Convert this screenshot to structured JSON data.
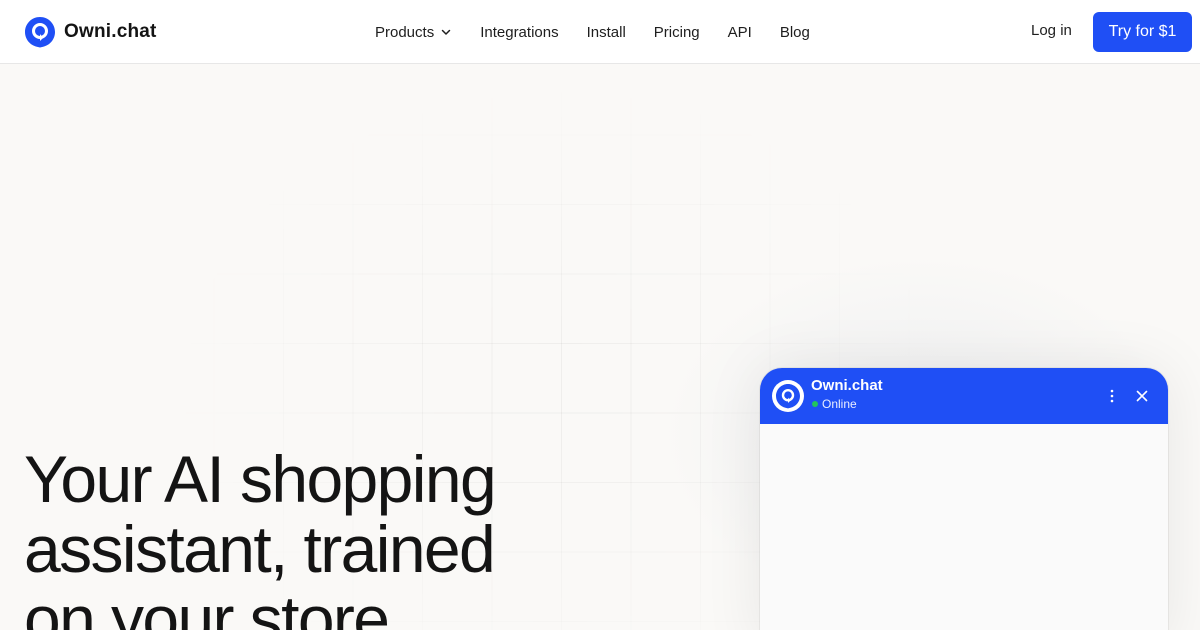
{
  "brand": {
    "name": "Owni.chat",
    "color": "#1f4ff5"
  },
  "nav": {
    "items": [
      {
        "label": "Products",
        "has_dropdown": true
      },
      {
        "label": "Integrations"
      },
      {
        "label": "Install"
      },
      {
        "label": "Pricing"
      },
      {
        "label": "API"
      },
      {
        "label": "Blog"
      }
    ]
  },
  "auth": {
    "login_label": "Log in",
    "cta_label": "Try for $1"
  },
  "hero": {
    "line1": "Your AI shopping",
    "line2": "assistant, trained",
    "line3": "on your store"
  },
  "chat_widget": {
    "title": "Owni.chat",
    "status": "Online",
    "status_color": "#22c55e",
    "icons": [
      "more-vertical-icon",
      "close-icon"
    ]
  }
}
